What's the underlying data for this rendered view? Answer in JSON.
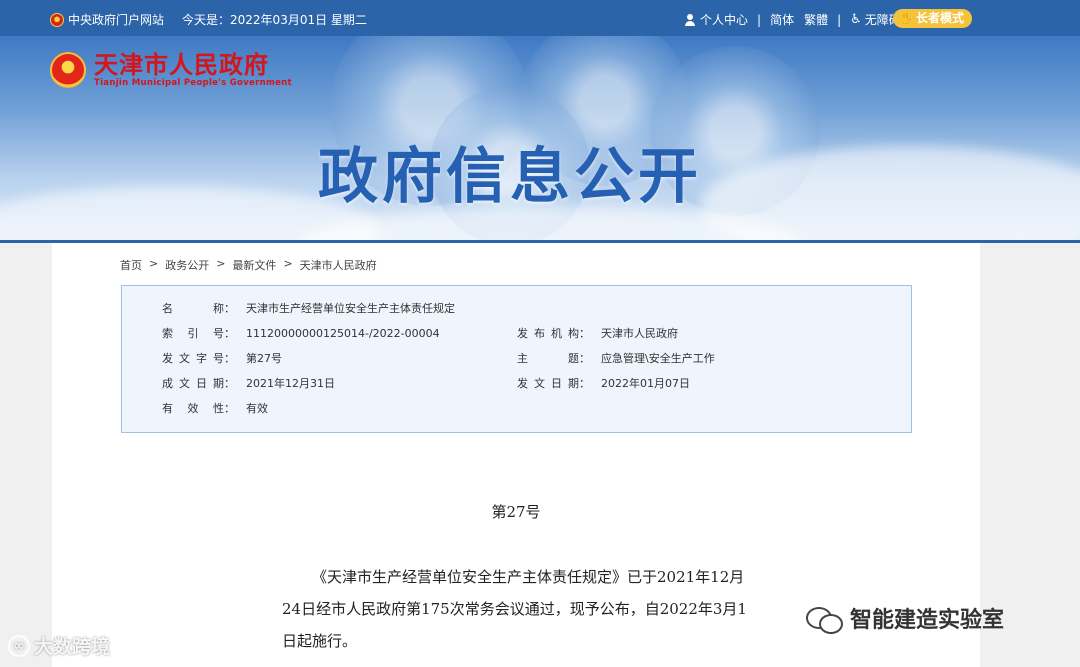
{
  "topbar": {
    "portal_link": "中央政府门户网站",
    "date": "今天是：2022年03月01日 星期二",
    "personal_center": "个人中心",
    "simplified": "简体",
    "traditional": "繁體",
    "accessibility": "无障碍",
    "elder_mode": "长者模式",
    "separator": "|"
  },
  "banner": {
    "logo_cn": "天津市人民政府",
    "logo_en": "Tianjin Municipal People's Government",
    "title": "政府信息公开"
  },
  "breadcrumb": [
    "首页",
    "政务公开",
    "最新文件",
    "天津市人民政府"
  ],
  "breadcrumb_sep": ">",
  "meta": {
    "name_label": "名称",
    "name_value": "天津市生产经营单位安全生产主体责任规定",
    "index_label": "索引号",
    "index_value": "11120000000125014-/2022-00004",
    "publisher_label": "发布机构",
    "publisher_value": "天津市人民政府",
    "docno_label": "发文字号",
    "docno_value": "第27号",
    "topic_label": "主题",
    "topic_value": "应急管理\\安全生产工作",
    "created_label": "成文日期",
    "created_value": "2021年12月31日",
    "issued_label": "发文日期",
    "issued_value": "2022年01月07日",
    "validity_label": "有效性",
    "validity_value": "有效",
    "colon": "："
  },
  "document": {
    "number": "第27号",
    "paragraph": "《天津市生产经营单位安全生产主体责任规定》已于2021年12月24日经市人民政府第175次常务会议通过，现予公布，自2022年3月1日起施行。"
  },
  "watermarks": {
    "left": "大数跨境",
    "right": "智能建造实验室"
  },
  "colors": {
    "topbar": "#2b64a8",
    "brand_red": "#d4151b",
    "title_blue": "#2560b3",
    "elder_btn": "#f5c33b"
  }
}
